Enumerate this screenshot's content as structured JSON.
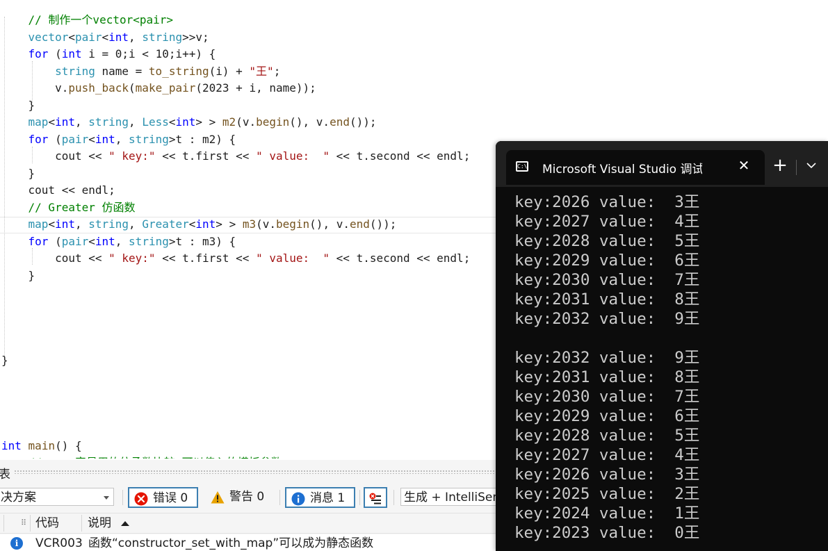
{
  "editor": {
    "lines": [
      [
        {
          "t": "    // 制作一个vector<pair>",
          "c": "cm"
        }
      ],
      [
        {
          "t": "    ",
          "c": "tx"
        },
        {
          "t": "vector",
          "c": "ty"
        },
        {
          "t": "<",
          "c": "tx"
        },
        {
          "t": "pair",
          "c": "ty"
        },
        {
          "t": "<",
          "c": "tx"
        },
        {
          "t": "int",
          "c": "kw"
        },
        {
          "t": ", ",
          "c": "tx"
        },
        {
          "t": "string",
          "c": "ty"
        },
        {
          "t": ">>v;",
          "c": "tx"
        }
      ],
      [
        {
          "t": "    ",
          "c": "tx"
        },
        {
          "t": "for",
          "c": "kw"
        },
        {
          "t": " (",
          "c": "tx"
        },
        {
          "t": "int",
          "c": "kw"
        },
        {
          "t": " i = 0;i < 10;i++) {",
          "c": "tx"
        }
      ],
      [
        {
          "t": "        ",
          "c": "tx"
        },
        {
          "t": "string",
          "c": "ty"
        },
        {
          "t": " name = ",
          "c": "tx"
        },
        {
          "t": "to_string",
          "c": "fn"
        },
        {
          "t": "(i) + ",
          "c": "tx"
        },
        {
          "t": "\"王\"",
          "c": "st"
        },
        {
          "t": ";",
          "c": "tx"
        }
      ],
      [
        {
          "t": "        v.",
          "c": "tx"
        },
        {
          "t": "push_back",
          "c": "fn"
        },
        {
          "t": "(",
          "c": "tx"
        },
        {
          "t": "make_pair",
          "c": "fn"
        },
        {
          "t": "(2023 + i, name));",
          "c": "tx"
        }
      ],
      [
        {
          "t": "    }",
          "c": "tx"
        }
      ],
      [
        {
          "t": "    ",
          "c": "tx"
        },
        {
          "t": "map",
          "c": "ty"
        },
        {
          "t": "<",
          "c": "tx"
        },
        {
          "t": "int",
          "c": "kw"
        },
        {
          "t": ", ",
          "c": "tx"
        },
        {
          "t": "string",
          "c": "ty"
        },
        {
          "t": ", ",
          "c": "tx"
        },
        {
          "t": "Less",
          "c": "ty"
        },
        {
          "t": "<",
          "c": "tx"
        },
        {
          "t": "int",
          "c": "kw"
        },
        {
          "t": "> > ",
          "c": "tx"
        },
        {
          "t": "m2",
          "c": "fn"
        },
        {
          "t": "(v.",
          "c": "tx"
        },
        {
          "t": "begin",
          "c": "fn"
        },
        {
          "t": "(), v.",
          "c": "tx"
        },
        {
          "t": "end",
          "c": "fn"
        },
        {
          "t": "());",
          "c": "tx"
        }
      ],
      [
        {
          "t": "    ",
          "c": "tx"
        },
        {
          "t": "for",
          "c": "kw"
        },
        {
          "t": " (",
          "c": "tx"
        },
        {
          "t": "pair",
          "c": "ty"
        },
        {
          "t": "<",
          "c": "tx"
        },
        {
          "t": "int",
          "c": "kw"
        },
        {
          "t": ", ",
          "c": "tx"
        },
        {
          "t": "string",
          "c": "ty"
        },
        {
          "t": ">t : m2) {",
          "c": "tx"
        }
      ],
      [
        {
          "t": "        cout << ",
          "c": "tx"
        },
        {
          "t": "\" key:\"",
          "c": "st"
        },
        {
          "t": " << t.first << ",
          "c": "tx"
        },
        {
          "t": "\" value:  \"",
          "c": "st"
        },
        {
          "t": " << t.second << endl;",
          "c": "tx"
        }
      ],
      [
        {
          "t": "    }",
          "c": "tx"
        }
      ],
      [
        {
          "t": "    cout << endl;",
          "c": "tx"
        }
      ],
      [
        {
          "t": "    // Greater 仿函数",
          "c": "cm"
        }
      ],
      [
        {
          "t": "    ",
          "c": "tx"
        },
        {
          "t": "map",
          "c": "ty"
        },
        {
          "t": "<",
          "c": "tx"
        },
        {
          "t": "int",
          "c": "kw"
        },
        {
          "t": ", ",
          "c": "tx"
        },
        {
          "t": "string",
          "c": "ty"
        },
        {
          "t": ", ",
          "c": "tx"
        },
        {
          "t": "Greater",
          "c": "ty"
        },
        {
          "t": "<",
          "c": "tx"
        },
        {
          "t": "int",
          "c": "kw"
        },
        {
          "t": "> > ",
          "c": "tx"
        },
        {
          "t": "m3",
          "c": "fn"
        },
        {
          "t": "(v.",
          "c": "tx"
        },
        {
          "t": "begin",
          "c": "fn"
        },
        {
          "t": "(), v.",
          "c": "tx"
        },
        {
          "t": "end",
          "c": "fn"
        },
        {
          "t": "());",
          "c": "tx"
        }
      ],
      [
        {
          "t": "    ",
          "c": "tx"
        },
        {
          "t": "for",
          "c": "kw"
        },
        {
          "t": " (",
          "c": "tx"
        },
        {
          "t": "pair",
          "c": "ty"
        },
        {
          "t": "<",
          "c": "tx"
        },
        {
          "t": "int",
          "c": "kw"
        },
        {
          "t": ", ",
          "c": "tx"
        },
        {
          "t": "string",
          "c": "ty"
        },
        {
          "t": ">t : m3) {",
          "c": "tx"
        }
      ],
      [
        {
          "t": "        cout << ",
          "c": "tx"
        },
        {
          "t": "\" key:\"",
          "c": "st"
        },
        {
          "t": " << t.first << ",
          "c": "tx"
        },
        {
          "t": "\" value:  \"",
          "c": "st"
        },
        {
          "t": " << t.second << endl;",
          "c": "tx"
        }
      ],
      [
        {
          "t": "    }",
          "c": "tx"
        }
      ],
      [],
      [],
      [],
      [],
      [
        {
          "t": "}",
          "c": "tx"
        }
      ],
      [],
      [],
      [],
      [],
      [
        {
          "t": "int",
          "c": "kw"
        },
        {
          "t": " ",
          "c": "tx"
        },
        {
          "t": "main",
          "c": "fn"
        },
        {
          "t": "() {",
          "c": "tx"
        }
      ],
      [
        {
          "t": "    // ... 容易用的仿函数比较 可以传入的模板参数",
          "c": "cm"
        }
      ]
    ]
  },
  "error_list": {
    "title": "表",
    "solution_combo": "决方案",
    "errors_label": "错误 0",
    "warnings_label": "警告 0",
    "messages_label": "消息 1",
    "build_combo": "生成 + IntelliSense",
    "col_code": "代码",
    "col_desc": "说明",
    "row": {
      "code": "VCR003",
      "desc": "函数“constructor_set_with_map”可以成为静态函数"
    }
  },
  "terminal": {
    "tab_title": "Microsoft Visual Studio 调试控制台",
    "output": [
      "key:2026 value:  3王",
      "key:2027 value:  4王",
      "key:2028 value:  5王",
      "key:2029 value:  6王",
      "key:2030 value:  7王",
      "key:2031 value:  8王",
      "key:2032 value:  9王",
      "",
      "key:2032 value:  9王",
      "key:2031 value:  8王",
      "key:2030 value:  7王",
      "key:2029 value:  6王",
      "key:2028 value:  5王",
      "key:2027 value:  4王",
      "key:2026 value:  3王",
      "key:2025 value:  2王",
      "key:2024 value:  1王",
      "key:2023 value:  0王"
    ]
  },
  "colors": {
    "keyword": "#0000ff",
    "type": "#2b91af",
    "comment": "#008000",
    "string": "#a31515",
    "function": "#74531f",
    "terminal_bg": "#0c0c0c",
    "terminal_text": "#cccccc"
  },
  "icons": [
    "terminal-app-icon",
    "close-icon",
    "plus-icon",
    "chevron-down-icon",
    "error-icon",
    "warning-icon",
    "info-icon",
    "filter-icon",
    "sort-up-icon"
  ]
}
